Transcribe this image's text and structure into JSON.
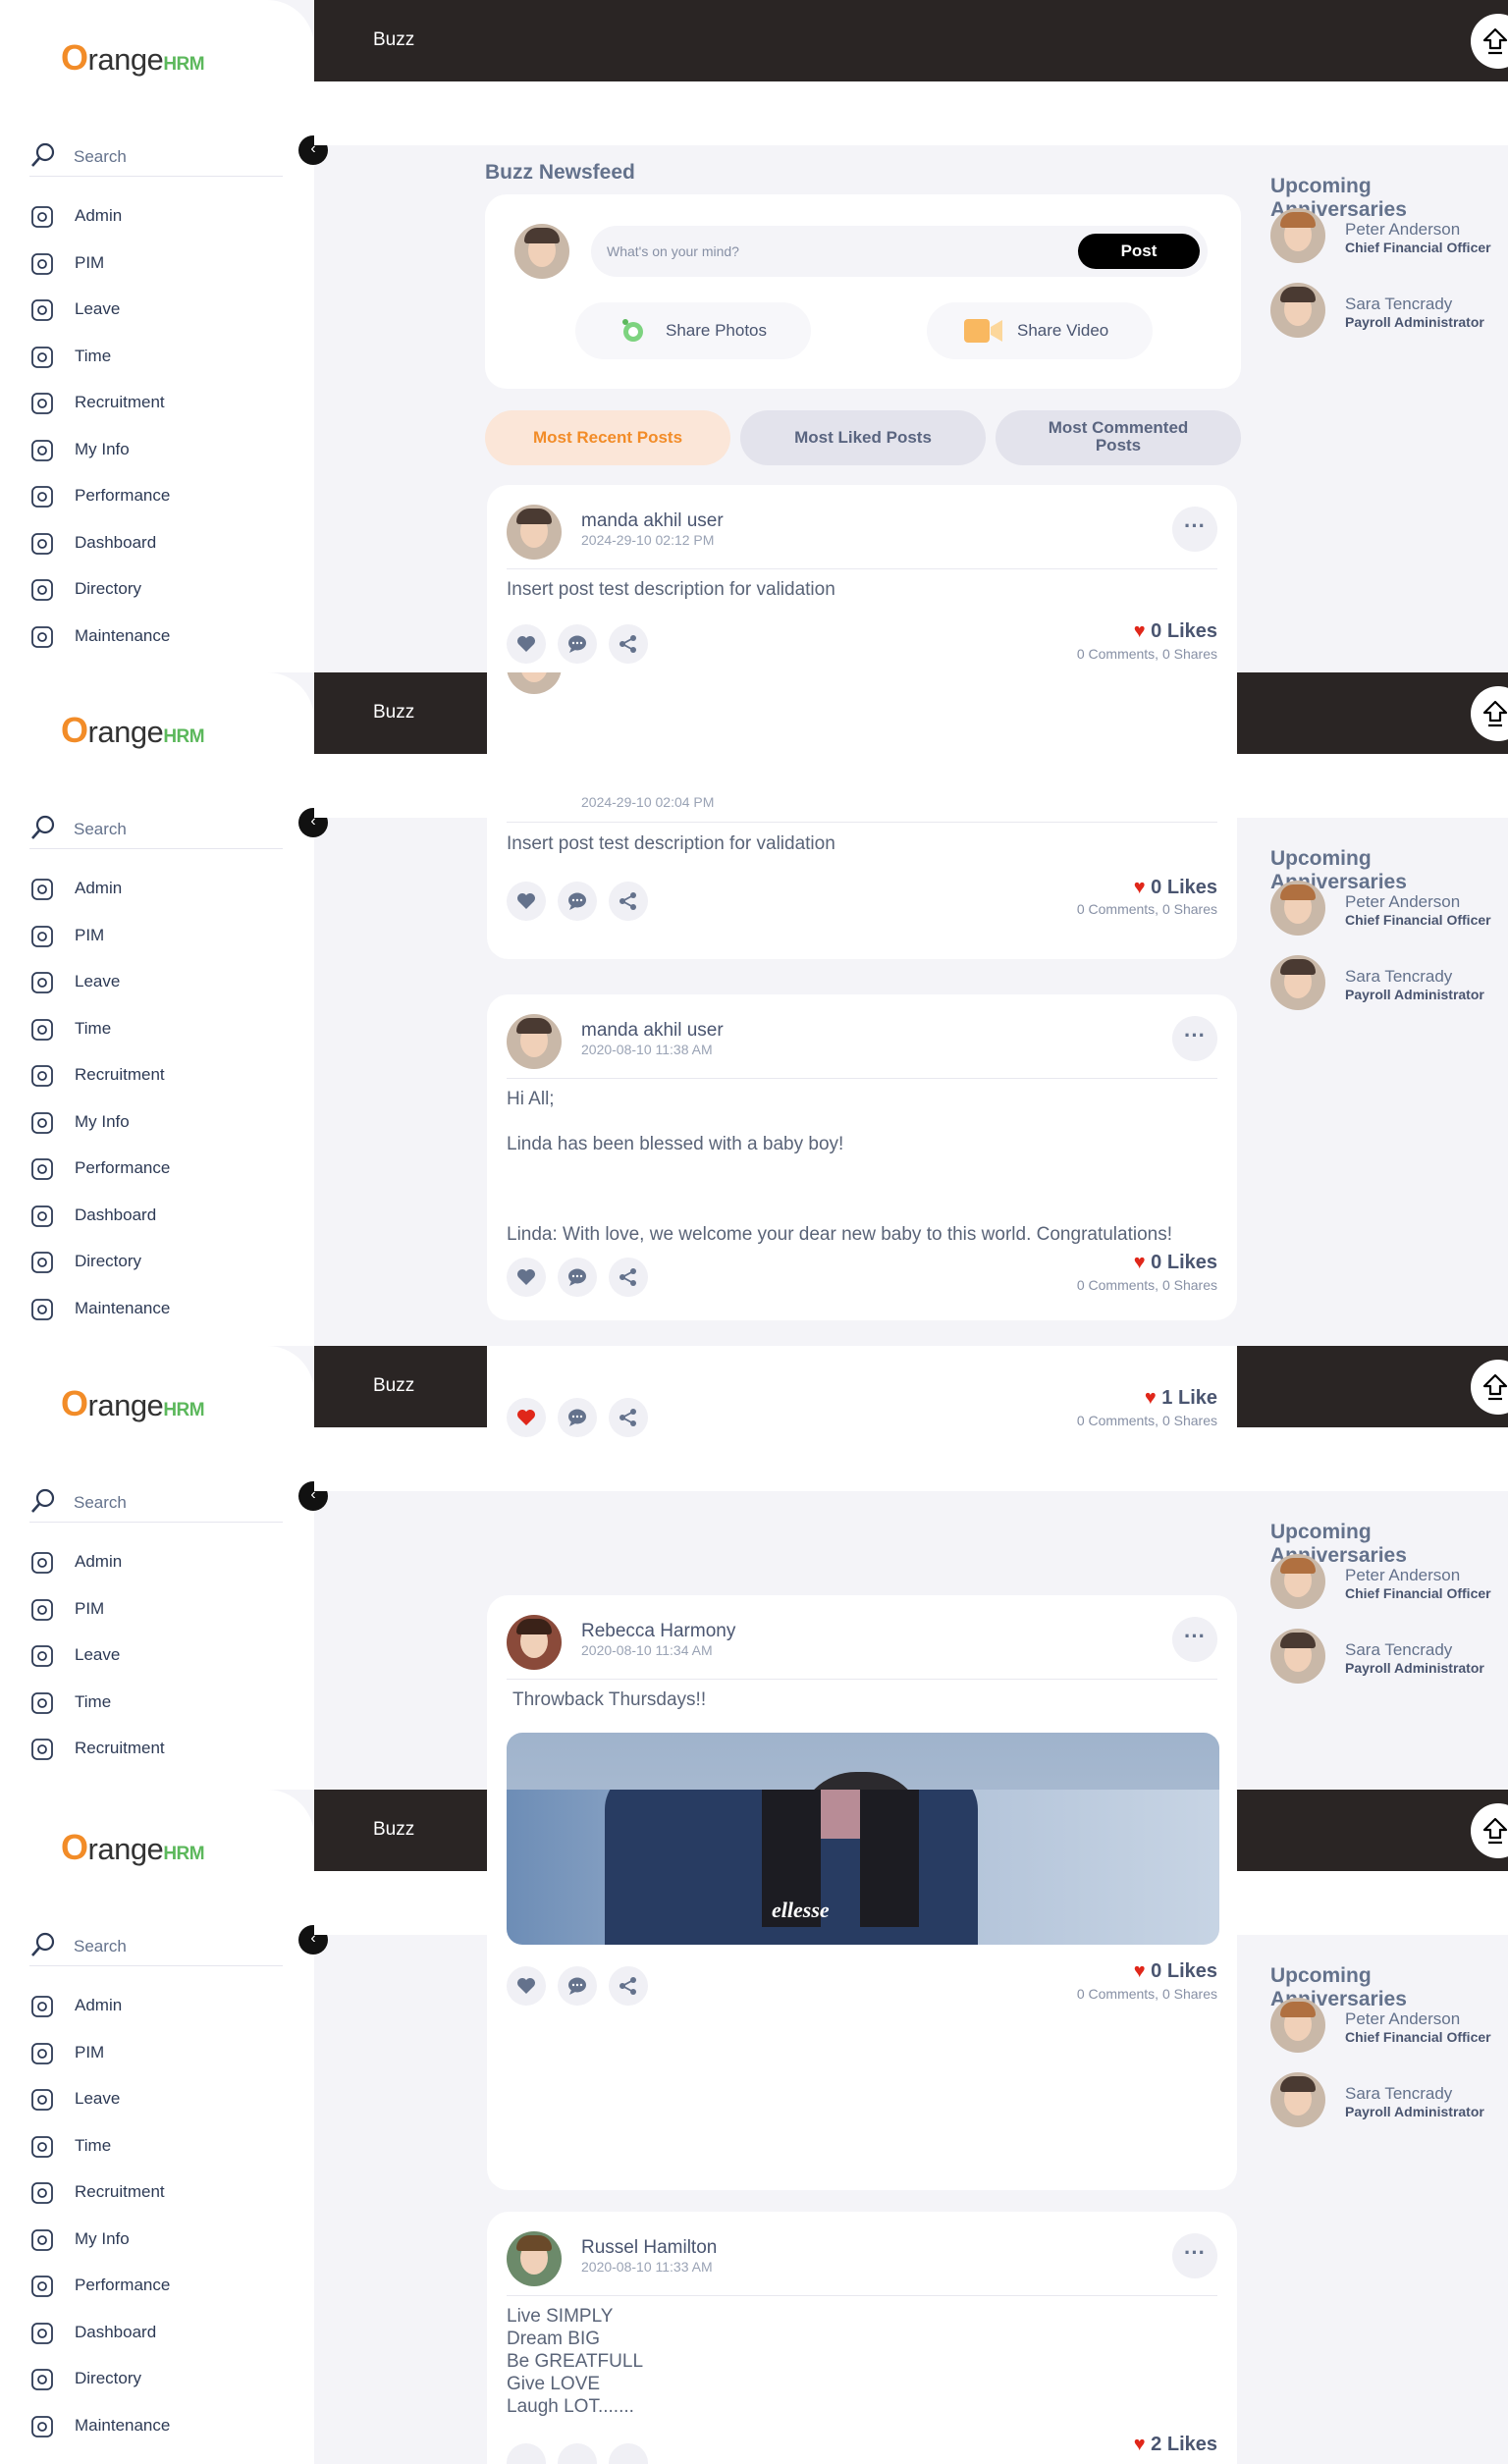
{
  "brand": {
    "o": "O",
    "rest": "range",
    "hrm": "HRM"
  },
  "topbar": {
    "title": "Buzz"
  },
  "sidebar": {
    "search_label": "Search",
    "collapse_icon": "chevron-left-icon",
    "items": [
      {
        "label": "Admin",
        "icon": "admin-icon"
      },
      {
        "label": "PIM",
        "icon": "pim-icon"
      },
      {
        "label": "Leave",
        "icon": "leave-icon"
      },
      {
        "label": "Time",
        "icon": "time-icon"
      },
      {
        "label": "Recruitment",
        "icon": "recruitment-icon"
      },
      {
        "label": "My Info",
        "icon": "myinfo-icon"
      },
      {
        "label": "Performance",
        "icon": "performance-icon"
      },
      {
        "label": "Dashboard",
        "icon": "dashboard-icon"
      },
      {
        "label": "Directory",
        "icon": "directory-icon"
      },
      {
        "label": "Maintenance",
        "icon": "maintenance-icon"
      }
    ]
  },
  "feed": {
    "title": "Buzz Newsfeed",
    "composer": {
      "placeholder": "What's on your mind?",
      "post_label": "Post",
      "share_photos": "Share Photos",
      "share_video": "Share Video"
    },
    "filters": {
      "recent": "Most Recent Posts",
      "liked": "Most Liked Posts",
      "commented": "Most Commented Posts"
    }
  },
  "anniversaries": {
    "title": "Upcoming Anniversaries",
    "people": [
      {
        "name": "Peter Anderson",
        "role": "Chief Financial Officer"
      },
      {
        "name": "Sara Tencrady",
        "role": "Payroll Administrator"
      }
    ]
  },
  "posts": {
    "p1": {
      "author": "manda akhil user",
      "time": "2024-29-10 02:12 PM",
      "text": "Insert post test description for validation",
      "likes": "0 Likes",
      "stats": "0 Comments, 0 Shares"
    },
    "p2": {
      "time": "2024-29-10 02:04 PM",
      "text": "Insert post test description for validation",
      "likes": "0 Likes",
      "stats": "0 Comments, 0 Shares"
    },
    "p3": {
      "author": "manda akhil user",
      "time": "2020-08-10 11:38 AM",
      "line1": "Hi All;",
      "line2": "Linda has been blessed with a baby boy!",
      "line3": "Linda: With love, we welcome your dear new baby to this world. Congratulations!",
      "likes": "0 Likes",
      "stats": "0 Comments, 0 Shares"
    },
    "p4": {
      "likes": "1 Like",
      "stats": "0 Comments, 0 Shares"
    },
    "p5": {
      "author": "Rebecca Harmony",
      "time": "2020-08-10 11:34 AM",
      "text": "Throwback Thursdays!!",
      "likes": "0 Likes",
      "stats": "0 Comments, 0 Shares",
      "photo_brand": "ellesse"
    },
    "p6": {
      "author": "Russel Hamilton",
      "time": "2020-08-10 11:33 AM",
      "lines": [
        "Live SIMPLY",
        "Dream BIG",
        "Be GREATFULL",
        "Give LOVE",
        "Laugh LOT......."
      ],
      "likes": "2 Likes"
    }
  }
}
